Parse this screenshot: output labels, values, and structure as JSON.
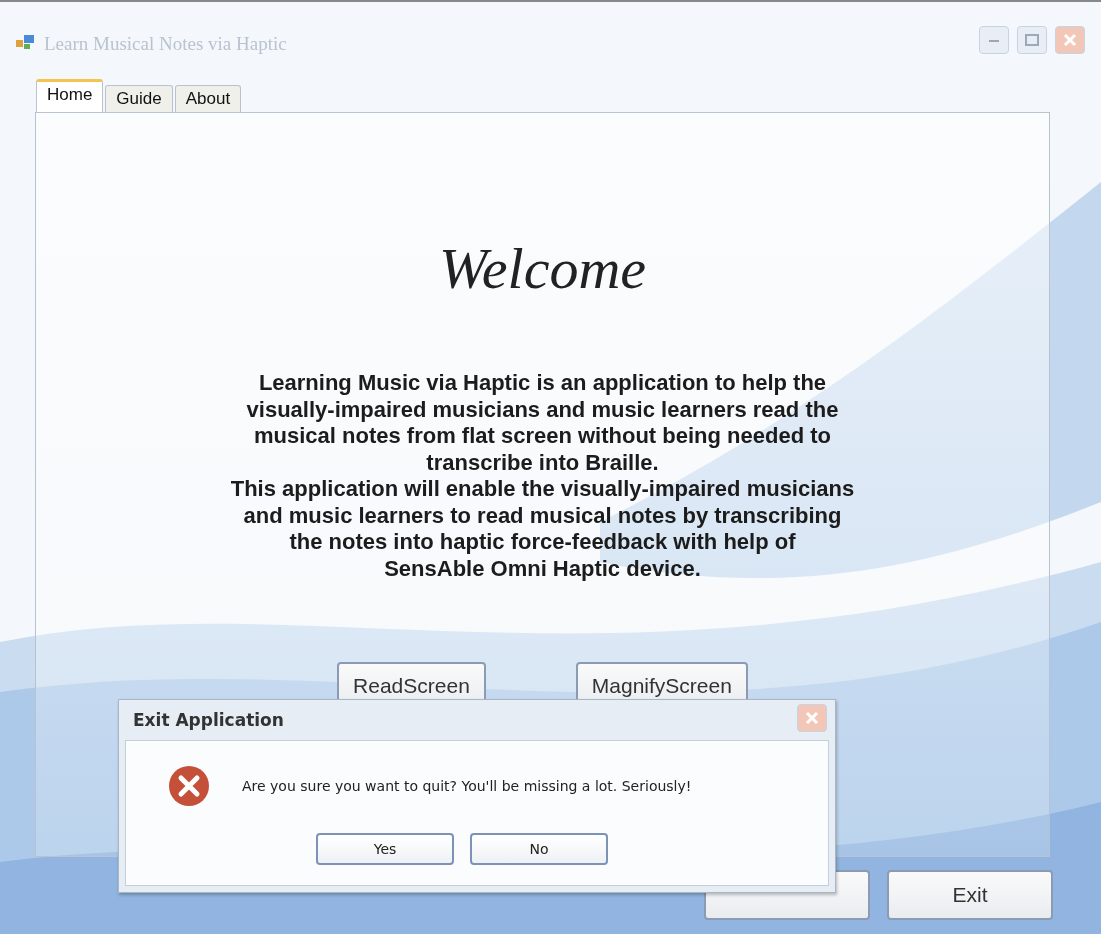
{
  "window": {
    "title": "Learn Musical Notes via Haptic"
  },
  "tabs": [
    {
      "label": "Home",
      "selected": true
    },
    {
      "label": "Guide",
      "selected": false
    },
    {
      "label": "About",
      "selected": false
    }
  ],
  "heading": "Welcome",
  "description": [
    "Learning Music via Haptic is an application to help the",
    "visually-impaired musicians and music learners read the",
    "musical notes from flat screen without being needed to",
    "transcribe into Braille.",
    "This application will enable the visually-impaired musicians",
    "and music learners to read musical notes by transcribing",
    "the notes into haptic force-feedback with help of",
    "SensAble Omni Haptic device."
  ],
  "panel_buttons": [
    "ReadScreen",
    "MagnifyScreen"
  ],
  "footer_buttons": [
    "Exit"
  ],
  "dialog": {
    "title": "Exit Application",
    "message": "Are you sure you want to quit? You'll be missing a lot. Seriously!",
    "buttons": [
      "Yes",
      "No"
    ]
  }
}
